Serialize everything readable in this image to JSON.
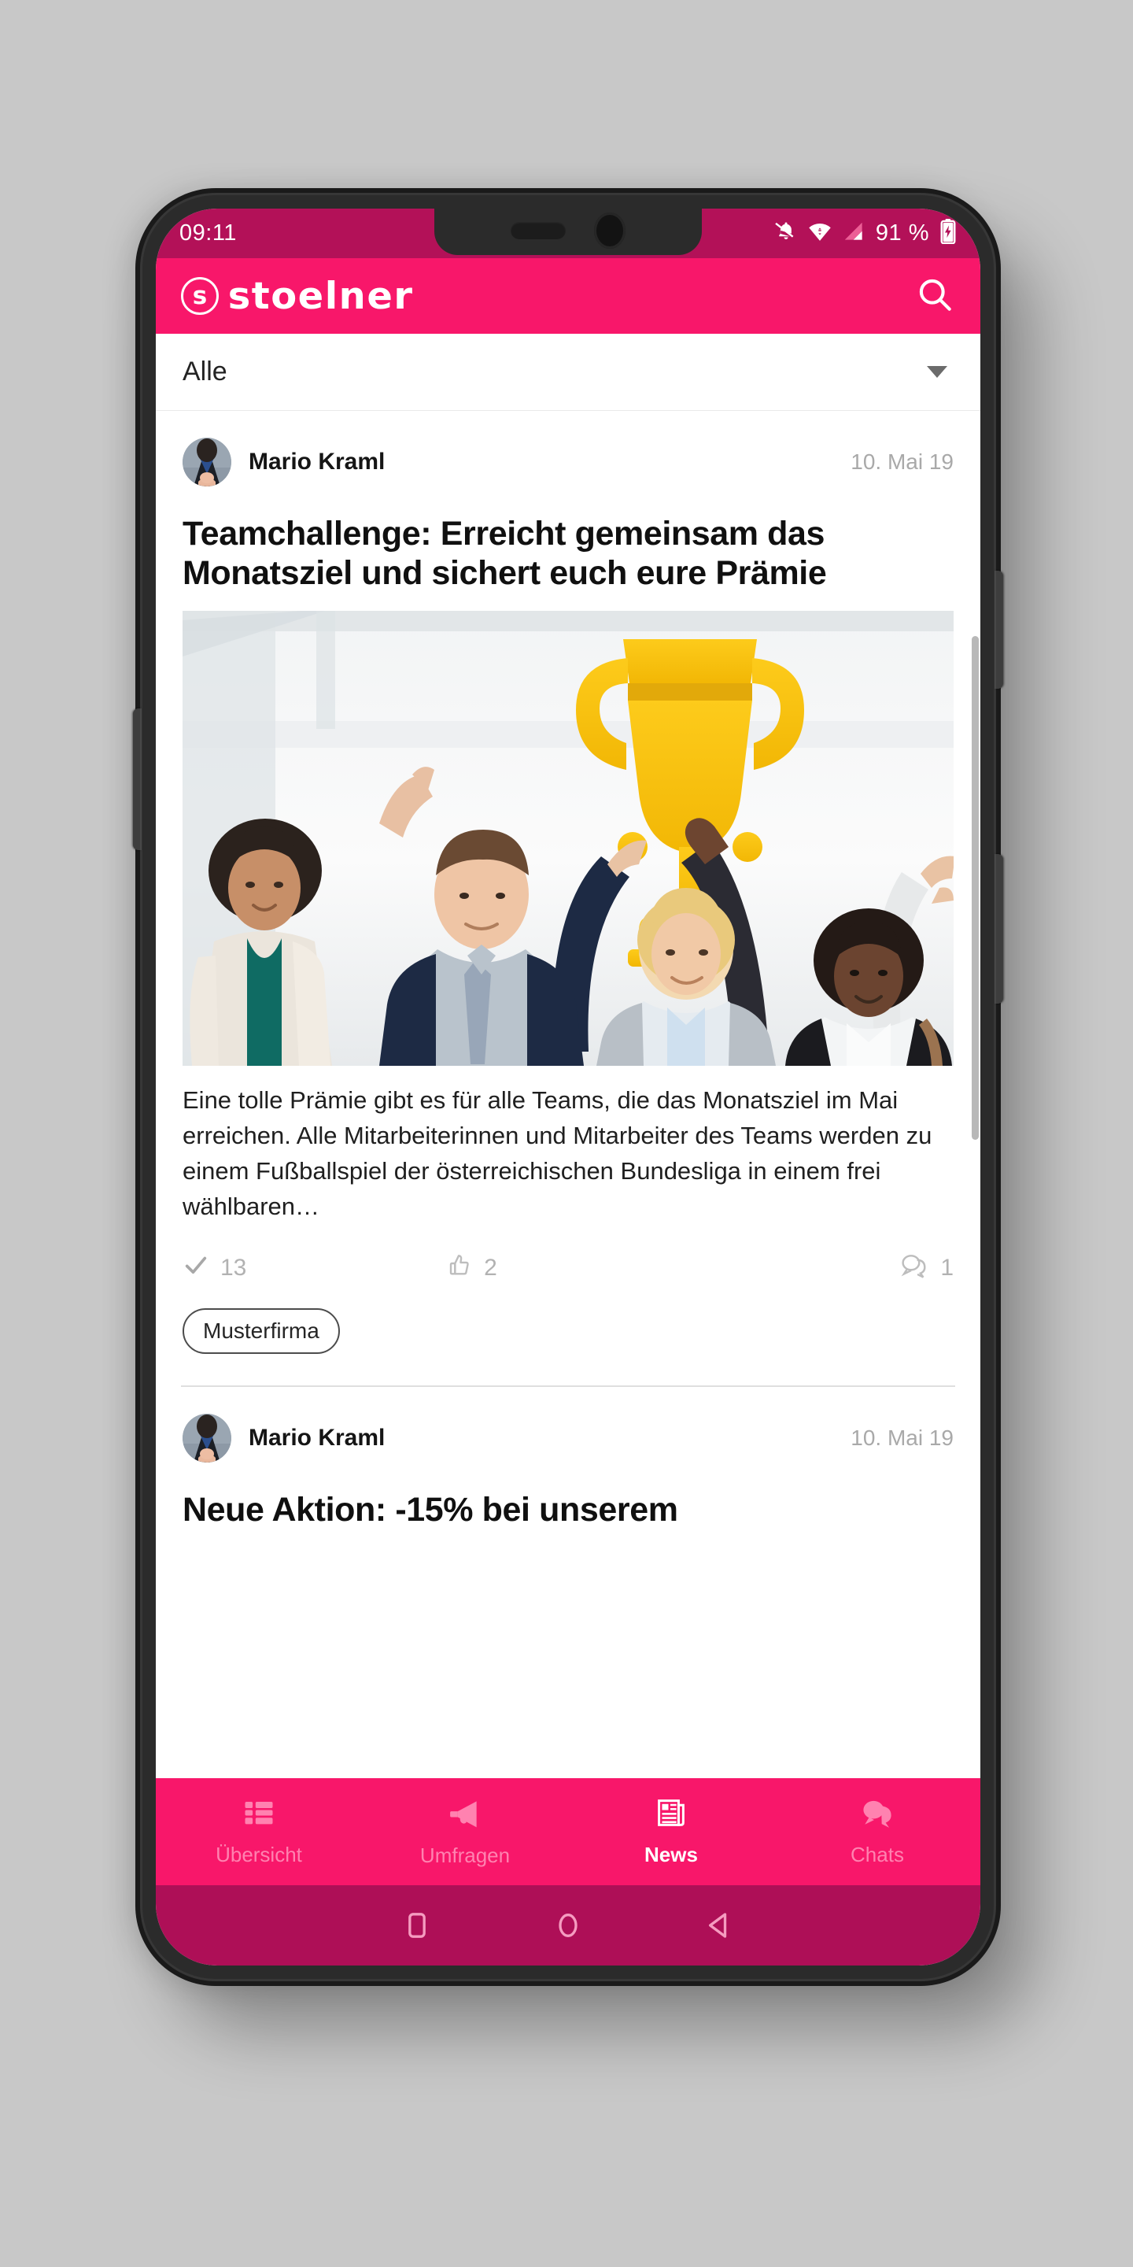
{
  "device": {
    "frame_color": "#2b2b2b",
    "background_color": "#c8c8c8"
  },
  "status_bar": {
    "time": "09:11",
    "battery_percent": "91 %",
    "background_color": "#b31158",
    "icons": [
      "notifications-off-icon",
      "wifi-icon",
      "signal-icon",
      "battery-charging-icon"
    ]
  },
  "app_header": {
    "brand_mark": "s",
    "brand_name": "stoelner",
    "background_color": "#f8176a",
    "search_icon": "search-icon"
  },
  "filter": {
    "selected": "Alle",
    "chevron_icon": "chevron-down-icon"
  },
  "feed": {
    "posts": [
      {
        "author": "Mario Kraml",
        "date": "10. Mai 19",
        "title": "Teamchallenge: Erreicht gemeinsam das Monatsziel und sichert euch eure Prämie",
        "image_alt": "Vier jubelnde Kolleginnen und Kollegen halten einen großen goldenen Pokal hoch",
        "body": "Eine tolle Prämie gibt es für alle Teams, die das Monatsziel im Mai erreichen. Alle Mitarbeiterinnen und Mitarbeiter des Teams werden zu einem Fußballspiel der österreichischen Bundesliga in einem frei wählbaren…",
        "stats": {
          "confirmations_icon": "check-icon",
          "confirmations": "13",
          "likes_icon": "thumbs-up-icon",
          "likes": "2",
          "comments_icon": "comment-icon",
          "comments": "1"
        },
        "tag": "Musterfirma"
      },
      {
        "author": "Mario Kraml",
        "date": "10. Mai 19",
        "title": "Neue Aktion: -15% bei unserem"
      }
    ]
  },
  "bottom_nav": {
    "active_index": 2,
    "items": [
      {
        "label": "Übersicht",
        "icon": "list-grid-icon"
      },
      {
        "label": "Umfragen",
        "icon": "megaphone-icon"
      },
      {
        "label": "News",
        "icon": "newspaper-icon"
      },
      {
        "label": "Chats",
        "icon": "chat-bubbles-icon"
      }
    ]
  },
  "android_nav": {
    "background_color": "#ae0f57",
    "buttons": [
      {
        "name": "recents-button",
        "icon": "square-icon"
      },
      {
        "name": "home-button",
        "icon": "circle-icon"
      },
      {
        "name": "back-button",
        "icon": "triangle-left-icon"
      }
    ]
  }
}
